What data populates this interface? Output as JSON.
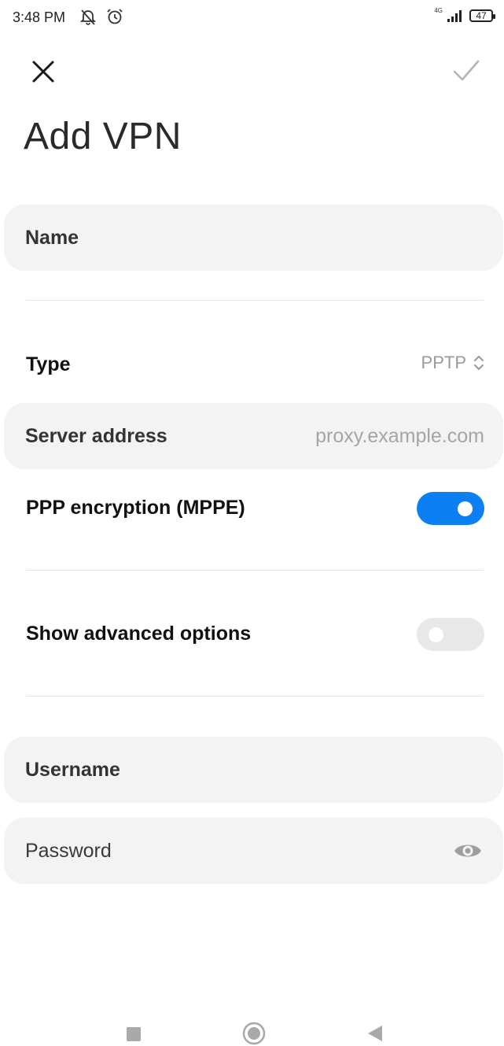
{
  "status_bar": {
    "time": "3:48 PM",
    "network_label": "4G",
    "battery": "47",
    "icons": [
      "muted-notification-icon",
      "alarm-icon",
      "signal-icon",
      "battery-icon"
    ]
  },
  "header": {
    "title": "Add VPN",
    "close_icon": "close-icon",
    "done_icon": "check-icon"
  },
  "form": {
    "name_label": "Name",
    "type_label": "Type",
    "type_value": "PPTP",
    "server_label": "Server address",
    "server_placeholder": "proxy.example.com",
    "ppp_label": "PPP encryption (MPPE)",
    "ppp_enabled": true,
    "advanced_label": "Show advanced options",
    "advanced_enabled": false,
    "username_label": "Username",
    "password_label": "Password"
  },
  "colors": {
    "accent": "#0c7ff2",
    "field_background": "#f3f3f3"
  },
  "nav_bar": {
    "icons": [
      "recents-icon",
      "home-icon",
      "back-icon"
    ]
  }
}
